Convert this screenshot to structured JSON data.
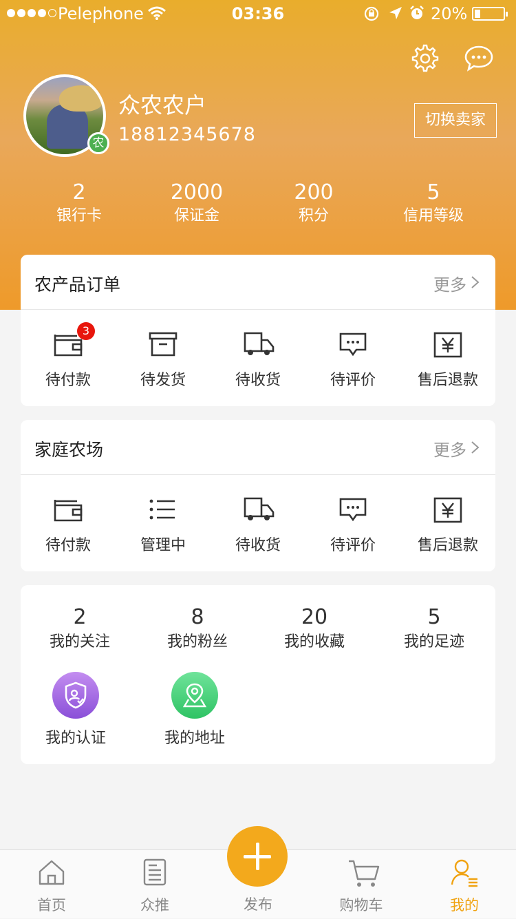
{
  "status_bar": {
    "carrier": "Pelephone",
    "time": "03:36",
    "battery": "20%"
  },
  "profile": {
    "name": "众农农户",
    "phone": "18812345678",
    "badge": "农",
    "switch_label": "切换卖家"
  },
  "stats": [
    {
      "value": "2",
      "label": "银行卡"
    },
    {
      "value": "2000",
      "label": "保证金"
    },
    {
      "value": "200",
      "label": "积分"
    },
    {
      "value": "5",
      "label": "信用等级"
    }
  ],
  "orders_card": {
    "title": "农产品订单",
    "more": "更多",
    "items": [
      {
        "label": "待付款",
        "icon": "wallet-icon",
        "badge": "3"
      },
      {
        "label": "待发货",
        "icon": "box-icon"
      },
      {
        "label": "待收货",
        "icon": "truck-icon"
      },
      {
        "label": "待评价",
        "icon": "comment-icon"
      },
      {
        "label": "售后退款",
        "icon": "yen-icon"
      }
    ]
  },
  "farm_card": {
    "title": "家庭农场",
    "more": "更多",
    "items": [
      {
        "label": "待付款",
        "icon": "wallet-icon"
      },
      {
        "label": "管理中",
        "icon": "list-icon"
      },
      {
        "label": "待收货",
        "icon": "truck-icon"
      },
      {
        "label": "待评价",
        "icon": "comment-icon"
      },
      {
        "label": "售后退款",
        "icon": "yen-icon"
      }
    ]
  },
  "my_card": {
    "stats": [
      {
        "value": "2",
        "label": "我的关注"
      },
      {
        "value": "8",
        "label": "我的粉丝"
      },
      {
        "value": "20",
        "label": "我的收藏"
      },
      {
        "value": "5",
        "label": "我的足迹"
      }
    ],
    "links": [
      {
        "label": "我的认证",
        "icon": "shield-user-icon"
      },
      {
        "label": "我的地址",
        "icon": "map-pin-icon"
      }
    ]
  },
  "tabbar": {
    "items": [
      {
        "label": "首页",
        "icon": "home-icon"
      },
      {
        "label": "众推",
        "icon": "document-icon"
      },
      {
        "label": "发布",
        "icon": "plus-icon"
      },
      {
        "label": "购物车",
        "icon": "cart-icon"
      },
      {
        "label": "我的",
        "icon": "user-icon"
      }
    ],
    "active": "我的"
  },
  "colors": {
    "accent": "#f0a20f",
    "header_top": "#e9ad2c",
    "badge_red": "#e8160c",
    "badge_green": "#4caf50"
  }
}
